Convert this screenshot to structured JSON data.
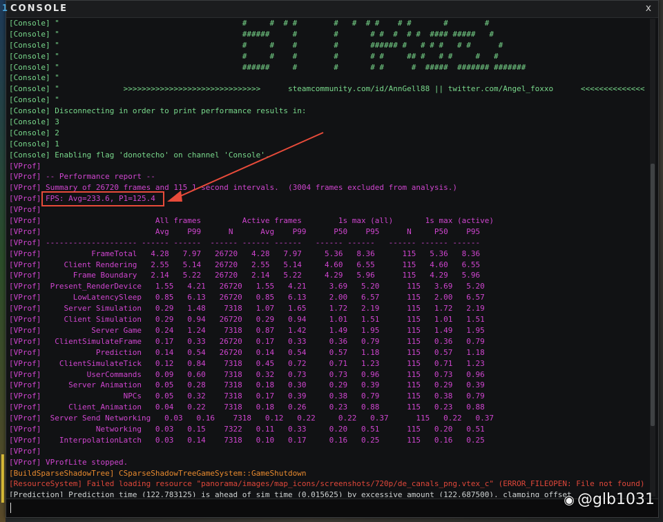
{
  "window": {
    "title": "CONSOLE",
    "title_accent": "1",
    "close_label": "x"
  },
  "log_lines": [
    {
      "src": "[Console]",
      "text": " \"                                        #     #  # #        #   #  # #    # #       #        #",
      "color": "green"
    },
    {
      "src": "[Console]",
      "text": " \"                                        ######     #        #       # #  #  # #  #### #####   #",
      "color": "green"
    },
    {
      "src": "[Console]",
      "text": " \"                                        #     #    #        #       ###### #   # # #   # #      #",
      "color": "green"
    },
    {
      "src": "[Console]",
      "text": " \"                                        #     #    #        #       # #     ## #   # #     #   #",
      "color": "green"
    },
    {
      "src": "[Console]",
      "text": " \"                                        ######     #        #       # #      #  #####  ####### #######",
      "color": "green"
    },
    {
      "src": "[Console]",
      "text": " \"",
      "color": "green"
    },
    {
      "src": "[Console]",
      "text": " \"              >>>>>>>>>>>>>>>>>>>>>>>>>>>>>>      steamcommunity.com/id/AnnGell88 || twitter.com/Angel_foxxo      <<<<<<<<<<<<<<",
      "color": "green"
    },
    {
      "src": "[Console]",
      "text": " \"",
      "color": "green"
    },
    {
      "src": "[Console]",
      "text": " Disconnecting in order to print performance results in:",
      "color": "green"
    },
    {
      "src": "[Console]",
      "text": " 3",
      "color": "green"
    },
    {
      "src": "[Console]",
      "text": " 2",
      "color": "green"
    },
    {
      "src": "[Console]",
      "text": " 1",
      "color": "green"
    },
    {
      "src": "[Console]",
      "text": " Enabling flag 'donotecho' on channel 'Console'.",
      "color": "green"
    },
    {
      "src": "[VProf]",
      "text": "",
      "color": "magenta"
    },
    {
      "src": "[VProf]",
      "text": " -- Performance report --",
      "color": "magenta"
    },
    {
      "src": "[VProf]",
      "text": " Summary of 26720 frames and 115 1-second intervals.  (3004 frames excluded from analysis.)",
      "color": "magenta"
    },
    {
      "src": "[VProf]",
      "text": " FPS: Avg=233.6, P1=125.4",
      "color": "magenta"
    },
    {
      "src": "[VProf]",
      "text": "",
      "color": "magenta"
    },
    {
      "src": "[VProf]",
      "text": "                         All frames         Active frames        1s max (all)       1s max (active)",
      "color": "magenta"
    },
    {
      "src": "[VProf]",
      "text": "                         Avg    P99      N      Avg    P99      P50    P95      N     P50    P95",
      "color": "magenta"
    },
    {
      "src": "[VProf]",
      "text": " -------------------- ------ ------  ------ ------ ------   ------ ------   ------ ------ ------",
      "color": "magenta"
    },
    {
      "src": "[VProf]",
      "text": "           FrameTotal   4.28   7.97   26720   4.28   7.97     5.36   8.36      115   5.36   8.36",
      "color": "magenta"
    },
    {
      "src": "[VProf]",
      "text": "     Client Rendering   2.55   5.14   26720   2.55   5.14     4.60   6.55      115   4.60   6.55",
      "color": "magenta"
    },
    {
      "src": "[VProf]",
      "text": "       Frame Boundary   2.14   5.22   26720   2.14   5.22     4.29   5.96      115   4.29   5.96",
      "color": "magenta"
    },
    {
      "src": "[VProf]",
      "text": "  Present_RenderDevice   1.55   4.21   26720   1.55   4.21     3.69   5.20      115   3.69   5.20",
      "color": "magenta"
    },
    {
      "src": "[VProf]",
      "text": "       LowLatencySleep   0.85   6.13   26720   0.85   6.13     2.00   6.57      115   2.00   6.57",
      "color": "magenta"
    },
    {
      "src": "[VProf]",
      "text": "     Server Simulation   0.29   1.48    7318   1.07   1.65     1.72   2.19      115   1.72   2.19",
      "color": "magenta"
    },
    {
      "src": "[VProf]",
      "text": "     Client Simulation   0.29   0.94   26720   0.29   0.94     1.01   1.51      115   1.01   1.51",
      "color": "magenta"
    },
    {
      "src": "[VProf]",
      "text": "           Server Game   0.24   1.24    7318   0.87   1.42     1.49   1.95      115   1.49   1.95",
      "color": "magenta"
    },
    {
      "src": "[VProf]",
      "text": "   ClientSimulateFrame   0.17   0.33   26720   0.17   0.33     0.36   0.79      115   0.36   0.79",
      "color": "magenta"
    },
    {
      "src": "[VProf]",
      "text": "            Prediction   0.14   0.54   26720   0.14   0.54     0.57   1.18      115   0.57   1.18",
      "color": "magenta"
    },
    {
      "src": "[VProf]",
      "text": "    ClientSimulateTick   0.12   0.84    7318   0.45   0.72     0.71   1.23      115   0.71   1.23",
      "color": "magenta"
    },
    {
      "src": "[VProf]",
      "text": "          UserCommands   0.09   0.60    7318   0.32   0.73     0.73   0.96      115   0.73   0.96",
      "color": "magenta"
    },
    {
      "src": "[VProf]",
      "text": "      Server Animation   0.05   0.28    7318   0.18   0.30     0.29   0.39      115   0.29   0.39",
      "color": "magenta"
    },
    {
      "src": "[VProf]",
      "text": "                  NPCs   0.05   0.32    7318   0.17   0.39     0.38   0.79      115   0.38   0.79",
      "color": "magenta"
    },
    {
      "src": "[VProf]",
      "text": "      Client_Animation   0.04   0.22    7318   0.18   0.26     0.23   0.88      115   0.23   0.88",
      "color": "magenta"
    },
    {
      "src": "[VProf]",
      "text": "  Server Send Networking   0.03   0.16    7318   0.12   0.22     0.22   0.37      115   0.22   0.37",
      "color": "magenta"
    },
    {
      "src": "[VProf]",
      "text": "            Networking   0.03   0.15    7322   0.11   0.33     0.20   0.51      115   0.20   0.51",
      "color": "magenta"
    },
    {
      "src": "[VProf]",
      "text": "    InterpolationLatch   0.03   0.14    7318   0.10   0.17     0.16   0.25      115   0.16   0.25",
      "color": "magenta"
    },
    {
      "src": "[VProf]",
      "text": "",
      "color": "magenta"
    },
    {
      "src": "[VProf]",
      "text": " VProfLite stopped.",
      "color": "magenta"
    },
    {
      "src": "[BuildSparseShadowTree]",
      "text": " CSparseShadowTreeGameSystem::GameShutdown",
      "color": "orange"
    },
    {
      "src": "[ResourceSystem]",
      "text": " Failed loading resource \"panorama/images/map_icons/screenshots/720p/de_canals_png.vtex_c\" (ERROR_FILEOPEN: File not found)",
      "color": "red"
    },
    {
      "src": "[Prediction]",
      "text": " Prediction time (122.783125) is ahead of sim time (0.015625) by excessive amount (122.687500), clamping offset",
      "color": "white"
    }
  ],
  "input": {
    "value": "",
    "placeholder": ""
  },
  "watermark": {
    "icon": "weibo-icon",
    "text": "@glb1031"
  },
  "colors": {
    "green": "#79d98c",
    "magenta": "#cf45cf",
    "orange": "#e88a2e",
    "red": "#e0473a",
    "white": "#cfd3d3",
    "highlight": "#e84b3a"
  }
}
